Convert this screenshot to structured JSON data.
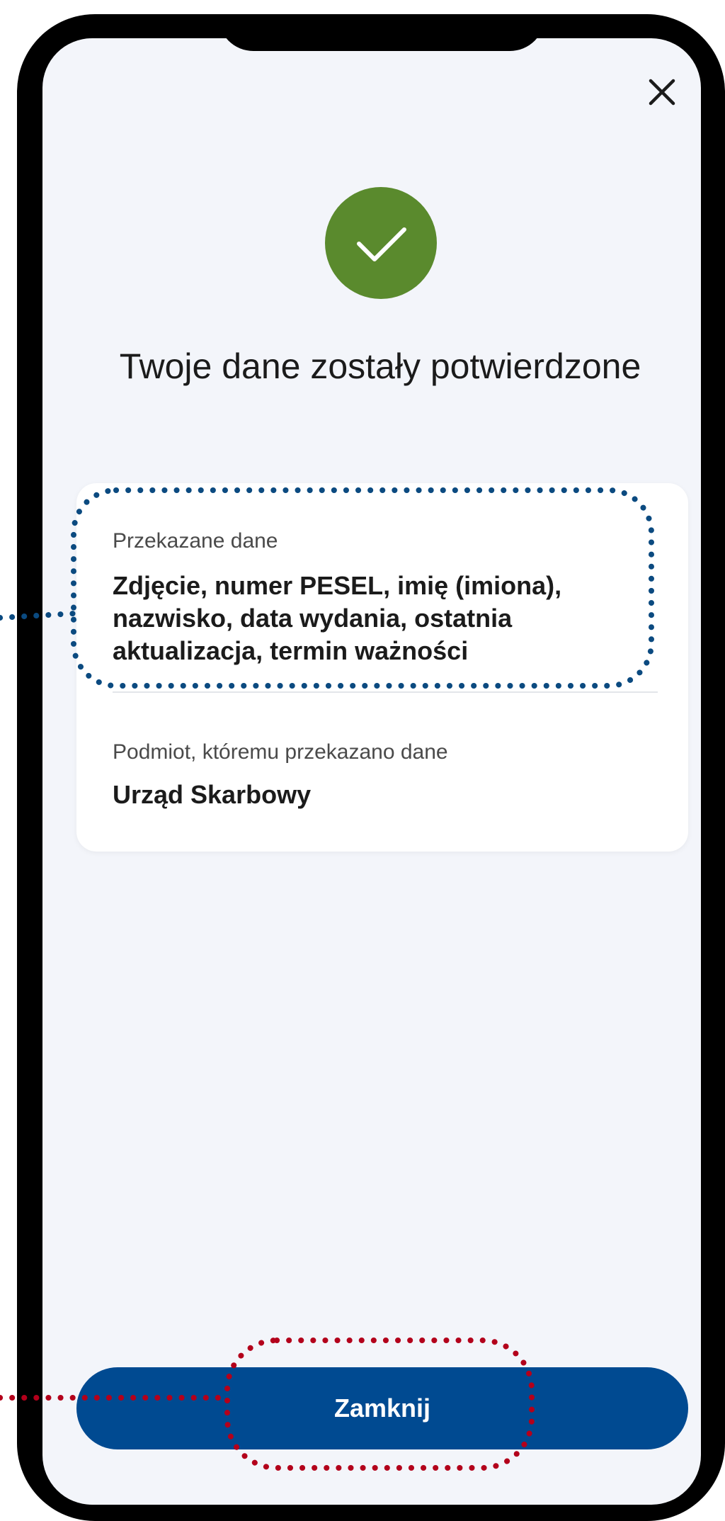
{
  "screen": {
    "title": "Twoje dane zostały potwierdzone"
  },
  "card": {
    "transferred_label": "Przekazane dane",
    "transferred_value": "Zdjęcie, numer PESEL, imię (imiona), nazwisko, data wydania, ostatnia aktualizacja, termin ważności",
    "recipient_label": "Podmiot, któremu przekazano dane",
    "recipient_value": "Urząd Skarbowy"
  },
  "actions": {
    "close_label": "Zamknij"
  },
  "icons": {
    "close": "close-icon",
    "success": "checkmark-icon"
  },
  "colors": {
    "success_green": "#5a8a2d",
    "primary_blue": "#004a91",
    "annotation_blue": "#0b4a80",
    "annotation_red": "#b3001b",
    "screen_bg": "#f3f5fa"
  }
}
